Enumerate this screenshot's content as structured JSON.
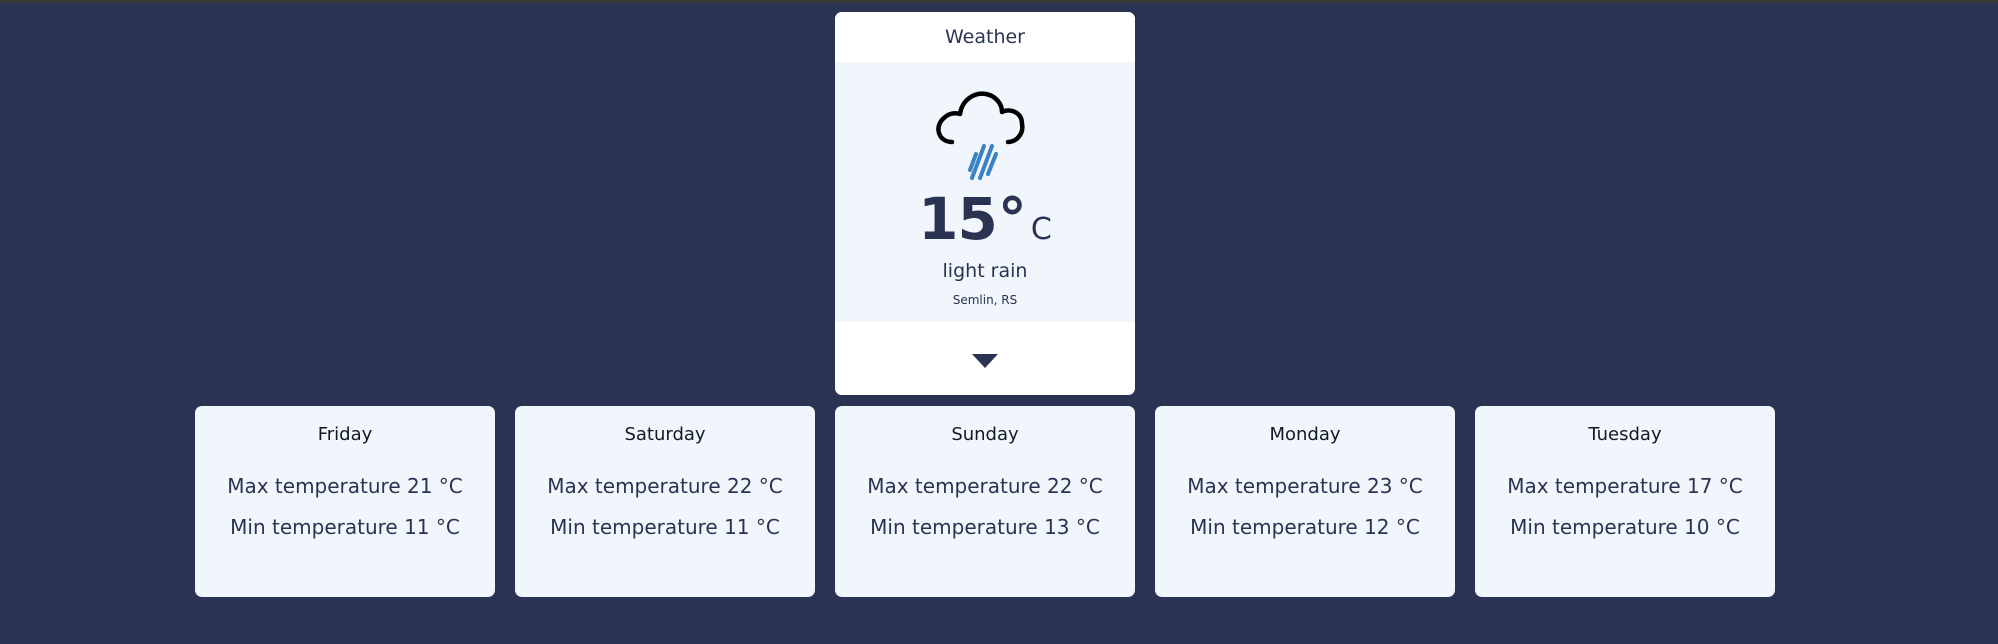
{
  "main": {
    "title": "Weather",
    "icon": "rain-cloud-icon",
    "temperature": "15",
    "degree_symbol": "°",
    "unit": "C",
    "description": "light rain",
    "location": "Semlin, RS",
    "expand_icon": "chevron-down-icon"
  },
  "colors": {
    "background": "#2a3352",
    "card": "#f1f6fd",
    "rain": "#3b82c4",
    "text": "#2a3352"
  },
  "forecast": [
    {
      "day": "Friday",
      "max": "Max temperature 21 °C",
      "min": "Min temperature 11 °C"
    },
    {
      "day": "Saturday",
      "max": "Max temperature 22 °C",
      "min": "Min temperature 11 °C"
    },
    {
      "day": "Sunday",
      "max": "Max temperature 22 °C",
      "min": "Min temperature 13 °C"
    },
    {
      "day": "Monday",
      "max": "Max temperature 23 °C",
      "min": "Min temperature 12 °C"
    },
    {
      "day": "Tuesday",
      "max": "Max temperature 17 °C",
      "min": "Min temperature 10 °C"
    }
  ]
}
